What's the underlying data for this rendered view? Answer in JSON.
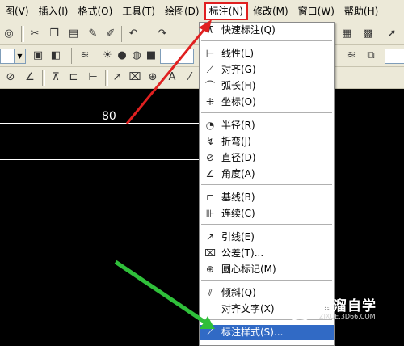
{
  "menubar": {
    "items": [
      {
        "label": "图(V)"
      },
      {
        "label": "插入(I)"
      },
      {
        "label": "格式(O)"
      },
      {
        "label": "工具(T)"
      },
      {
        "label": "绘图(D)"
      },
      {
        "label": "标注(N)"
      },
      {
        "label": "修改(M)"
      },
      {
        "label": "窗口(W)"
      },
      {
        "label": "帮助(H)"
      }
    ]
  },
  "canvas": {
    "dimension_text": "80"
  },
  "dimension_menu": {
    "items": [
      {
        "label": "快速标注(Q)",
        "icon": "quick-dimension-icon"
      },
      {
        "label": "线性(L)",
        "icon": "linear-dimension-icon"
      },
      {
        "label": "对齐(G)",
        "icon": "aligned-dimension-icon"
      },
      {
        "label": "弧长(H)",
        "icon": "arc-length-icon"
      },
      {
        "label": "坐标(O)",
        "icon": "ordinate-icon"
      },
      {
        "label": "半径(R)",
        "icon": "radius-icon"
      },
      {
        "label": "折弯(J)",
        "icon": "jogged-icon"
      },
      {
        "label": "直径(D)",
        "icon": "diameter-icon"
      },
      {
        "label": "角度(A)",
        "icon": "angular-icon"
      },
      {
        "label": "基线(B)",
        "icon": "baseline-icon"
      },
      {
        "label": "连续(C)",
        "icon": "continue-icon"
      },
      {
        "label": "引线(E)",
        "icon": "leader-icon"
      },
      {
        "label": "公差(T)...",
        "icon": "tolerance-icon"
      },
      {
        "label": "圆心标记(M)",
        "icon": "center-mark-icon"
      },
      {
        "label": "倾斜(Q)",
        "icon": "oblique-icon"
      },
      {
        "label": "对齐文字(X)",
        "icon": ""
      },
      {
        "label": "标注样式(S)...",
        "icon": "dimension-style-icon"
      }
    ]
  },
  "watermark": {
    "name": "溜溜自学",
    "url": "ZIXUE.3D66.COM"
  },
  "colors": {
    "highlight": "#316ac5",
    "red_arrow": "#e02020",
    "green_arrow": "#2fbf3a"
  }
}
